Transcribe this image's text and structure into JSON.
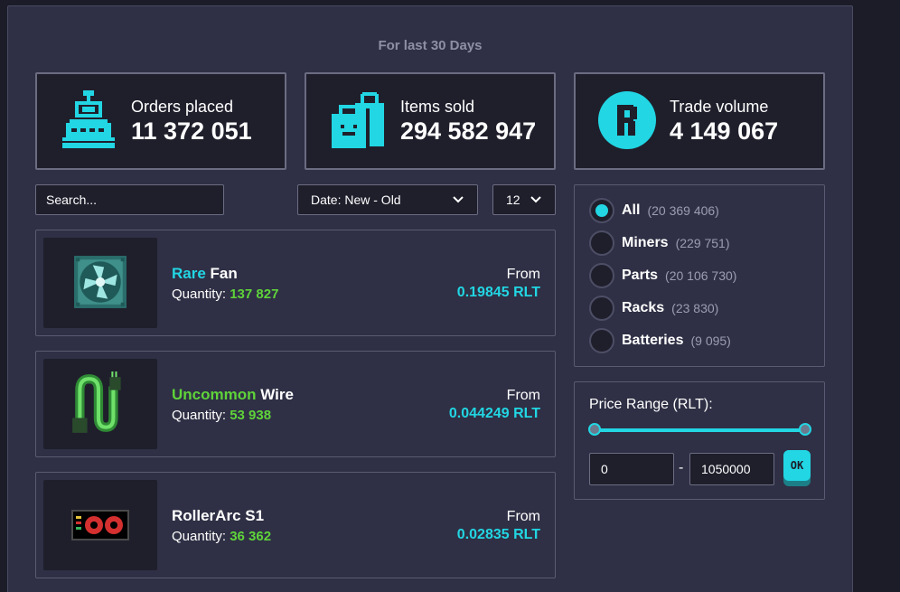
{
  "period_label": "For last 30 Days",
  "stats": [
    {
      "label": "Orders placed",
      "value": "11 372 051",
      "icon": "cash-register-icon"
    },
    {
      "label": "Items sold",
      "value": "294 582 947",
      "icon": "shopping-bag-icon"
    },
    {
      "label": "Trade volume",
      "value": "4 149 067",
      "icon": "rlt-coin-icon"
    }
  ],
  "search": {
    "placeholder": "Search..."
  },
  "sort": {
    "selected": "Date: New - Old"
  },
  "per_page": {
    "selected": "12"
  },
  "items": [
    {
      "rarity": "Rare",
      "rarity_color": "#22d6e3",
      "name": "Fan",
      "quantity_label": "Quantity:",
      "quantity": "137 827",
      "from_label": "From",
      "price": "0.19845 RLT",
      "icon": "fan-icon"
    },
    {
      "rarity": "Uncommon",
      "rarity_color": "#5fd33a",
      "name": "Wire",
      "quantity_label": "Quantity:",
      "quantity": "53 938",
      "from_label": "From",
      "price": "0.044249 RLT",
      "icon": "wire-icon"
    },
    {
      "rarity": "",
      "rarity_color": "#ffffff",
      "name": "RollerArc S1",
      "quantity_label": "Quantity:",
      "quantity": "36 362",
      "from_label": "From",
      "price": "0.02835 RLT",
      "icon": "graphics-card-icon"
    }
  ],
  "categories": [
    {
      "label": "All",
      "count": "(20 369 406)",
      "selected": true
    },
    {
      "label": "Miners",
      "count": "(229 751)",
      "selected": false
    },
    {
      "label": "Parts",
      "count": "(20 106 730)",
      "selected": false
    },
    {
      "label": "Racks",
      "count": "(23 830)",
      "selected": false
    },
    {
      "label": "Batteries",
      "count": "(9 095)",
      "selected": false
    }
  ],
  "price_range": {
    "title": "Price Range (RLT):",
    "min": "0",
    "max": "1050000",
    "separator": "-",
    "ok_label": "OK"
  },
  "colors": {
    "accent": "#22d6e3",
    "green": "#5fd33a",
    "panel": "#2f3045",
    "dark": "#1f1f2c"
  }
}
